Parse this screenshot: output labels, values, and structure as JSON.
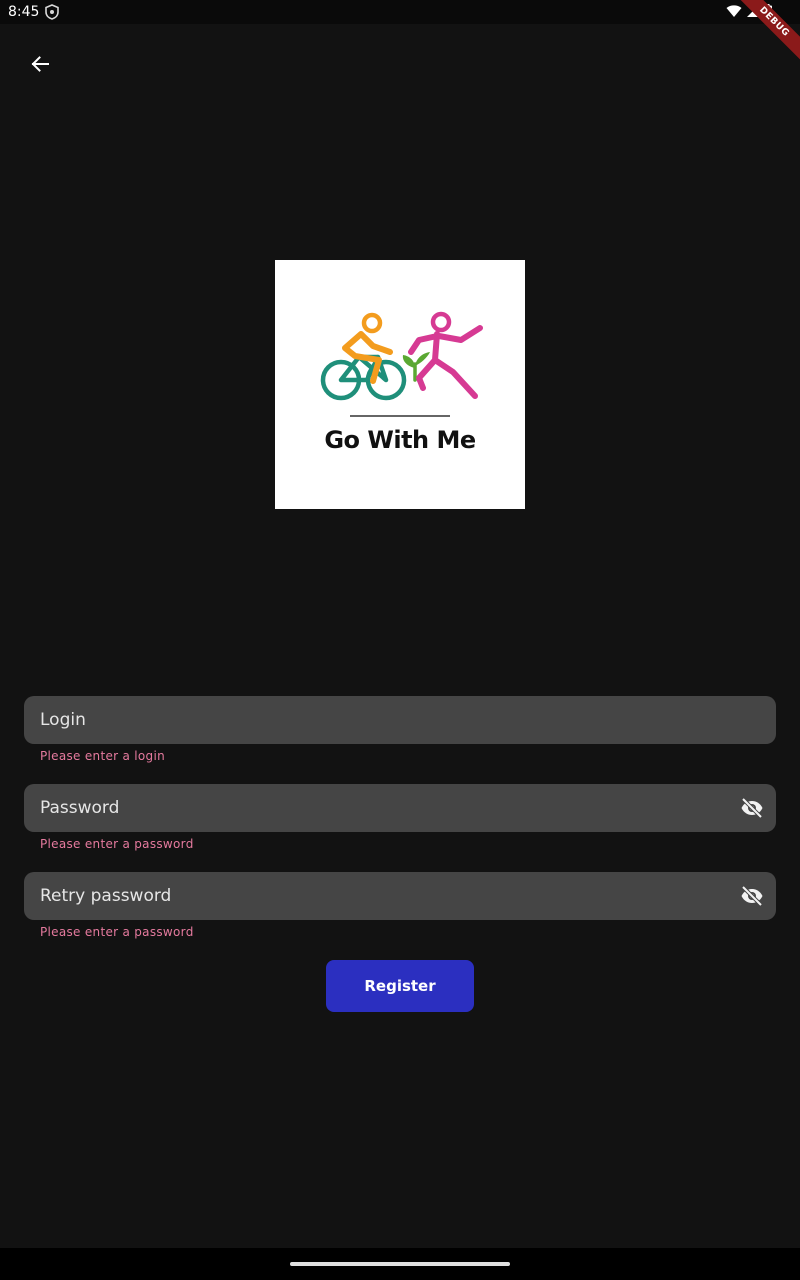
{
  "status_bar": {
    "time": "8:45",
    "icons": [
      "shield-icon",
      "wifi-icon",
      "signal-icon",
      "battery-icon"
    ]
  },
  "debug_banner": {
    "label": "DEBUG"
  },
  "header": {
    "back_icon": "arrow-back-icon"
  },
  "logo": {
    "text": "Go With Me",
    "colors": {
      "cyclist": "#f39c1e",
      "bicycle": "#1f8f7a",
      "runner": "#d63a93",
      "leaf": "#5aa832"
    }
  },
  "form": {
    "login": {
      "placeholder": "Login",
      "value": "",
      "error": "Please enter a login"
    },
    "password": {
      "placeholder": "Password",
      "value": "",
      "error": "Please enter a password",
      "toggle_icon": "visibility-off-icon"
    },
    "retry_password": {
      "placeholder": "Retry password",
      "value": "",
      "error": "Please enter a password",
      "toggle_icon": "visibility-off-icon"
    },
    "register_label": "Register"
  },
  "colors": {
    "background": "#121212",
    "field": "#454545",
    "error": "#e57a9e",
    "accent": "#2b2fc0"
  }
}
